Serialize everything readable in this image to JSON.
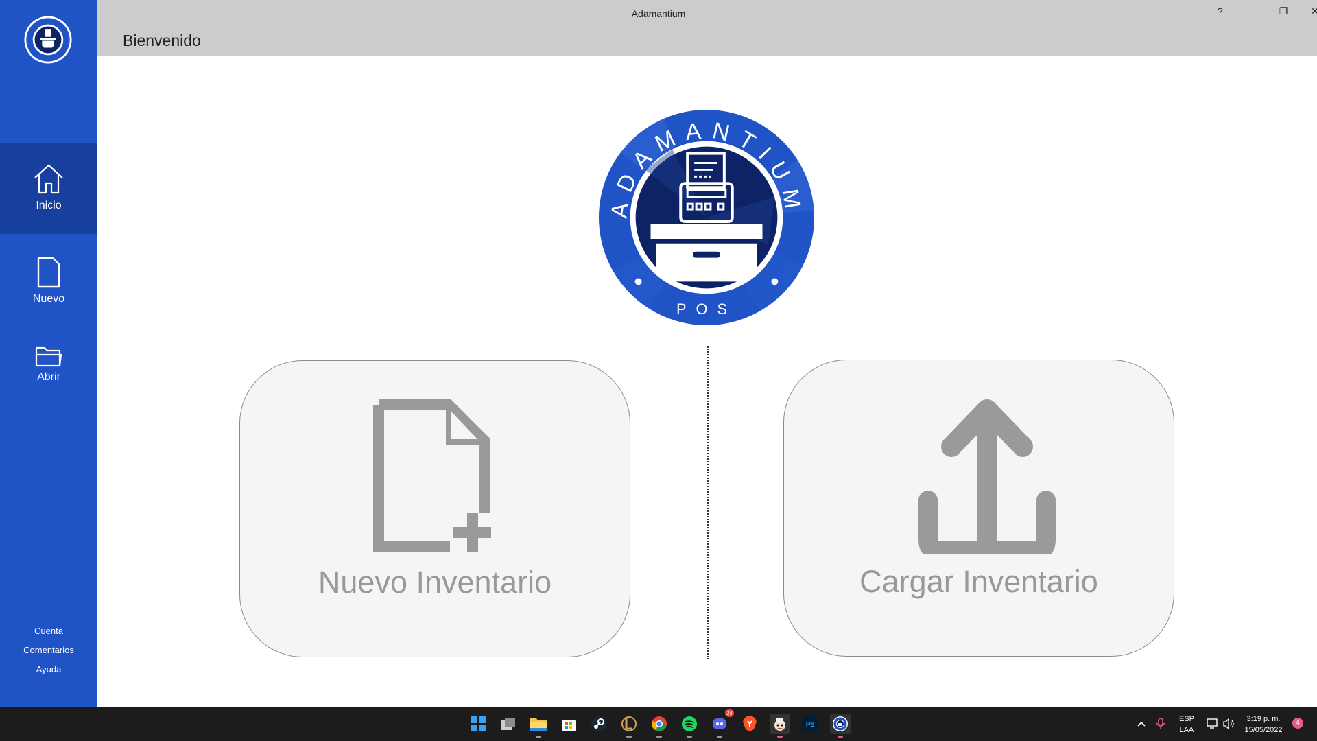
{
  "window": {
    "title": "Adamantium"
  },
  "header": {
    "page_title": "Bienvenido"
  },
  "window_controls": {
    "help": "?",
    "minimize": "—",
    "restore": "❐",
    "close": "✕"
  },
  "sidebar": {
    "nav": [
      {
        "label": "Inicio",
        "icon": "home-icon",
        "active": true
      },
      {
        "label": "Nuevo",
        "icon": "document-icon",
        "active": false
      },
      {
        "label": "Abrir",
        "icon": "folder-icon",
        "active": false
      }
    ],
    "links": [
      "Cuenta",
      "Comentarios",
      "Ayuda"
    ]
  },
  "logo": {
    "top_text": "ADAMANTIUM",
    "bottom_text": "POS"
  },
  "cards": {
    "new_inventory": {
      "label": "Nuevo Inventario",
      "icon": "new-document-icon"
    },
    "load_inventory": {
      "label": "Cargar Inventario",
      "icon": "upload-icon"
    }
  },
  "taskbar": {
    "apps": [
      "windows-start-icon",
      "task-view-icon",
      "file-explorer-icon",
      "microsoft-store-icon",
      "steam-icon",
      "league-of-legends-icon",
      "chrome-icon",
      "spotify-icon",
      "discord-icon",
      "brave-icon",
      "cuphead-icon",
      "photoshop-icon",
      "adamantium-icon"
    ],
    "discord_badge": "24",
    "language": "ESP",
    "layout": "LAA",
    "time": "3:19 p. m.",
    "date": "15/05/2022",
    "notification_count": "4"
  },
  "colors": {
    "sidebar": "#1f53c6",
    "sidebar_active": "#17409e",
    "header": "#cccccc",
    "card_bg": "#f5f5f5",
    "card_text": "#999999",
    "logo_blue": "#1f53c6",
    "logo_navy": "#0d2366"
  }
}
